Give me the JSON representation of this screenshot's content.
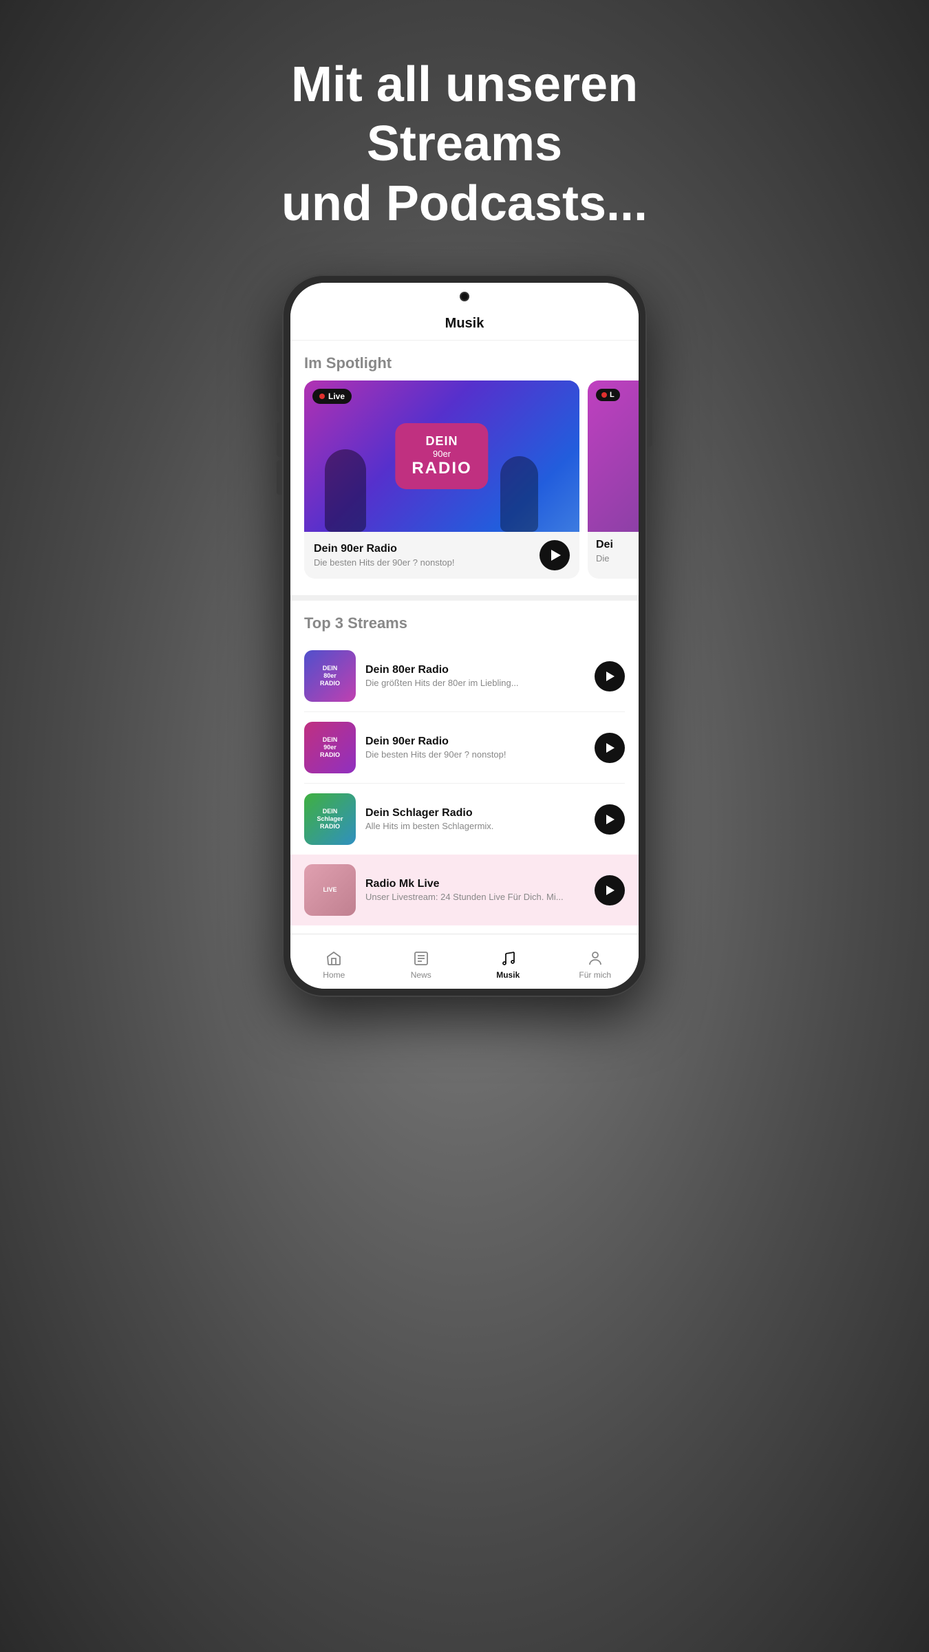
{
  "headline": {
    "line1": "Mit all unseren Streams",
    "line2": "und Podcasts..."
  },
  "app": {
    "header_title": "Musik"
  },
  "spotlight": {
    "section_title": "Im Spotlight",
    "card1": {
      "live_badge": "Live",
      "radio_name_top": "DEIN",
      "radio_name_mid": "90er",
      "radio_name_bot": "RADIO",
      "title": "Dein 90er Radio",
      "subtitle": "Die besten Hits der 90er ? nonstop!"
    },
    "card2": {
      "live_badge": "L",
      "title": "Dei",
      "subtitle": "Die"
    }
  },
  "top3": {
    "section_title": "Top 3 Streams",
    "items": [
      {
        "name": "Dein 80er Radio",
        "desc": "Die größten Hits der 80er im Liebling...",
        "thumb_label": "DEIN\n80er\nRADIO",
        "thumb_type": "80"
      },
      {
        "name": "Dein 90er Radio",
        "desc": "Die besten Hits der 90er ? nonstop!",
        "thumb_label": "DEIN\n90er\nRADIO",
        "thumb_type": "90"
      },
      {
        "name": "Dein Schlager Radio",
        "desc": "Alle Hits im besten Schlagermix.",
        "thumb_label": "DEIN\nSchlager\nRADIO",
        "thumb_type": "schlager"
      }
    ]
  },
  "highlighted_item": {
    "name": "Radio Mk Live",
    "desc": "Unser Livestream: 24 Stunden Live Für Dich. Mi...",
    "thumb_label": "LIVE"
  },
  "nav": {
    "items": [
      {
        "label": "Home",
        "icon": "home-icon",
        "active": false
      },
      {
        "label": "News",
        "icon": "news-icon",
        "active": false
      },
      {
        "label": "Musik",
        "icon": "music-icon",
        "active": true
      },
      {
        "label": "Für mich",
        "icon": "person-icon",
        "active": false
      }
    ]
  }
}
